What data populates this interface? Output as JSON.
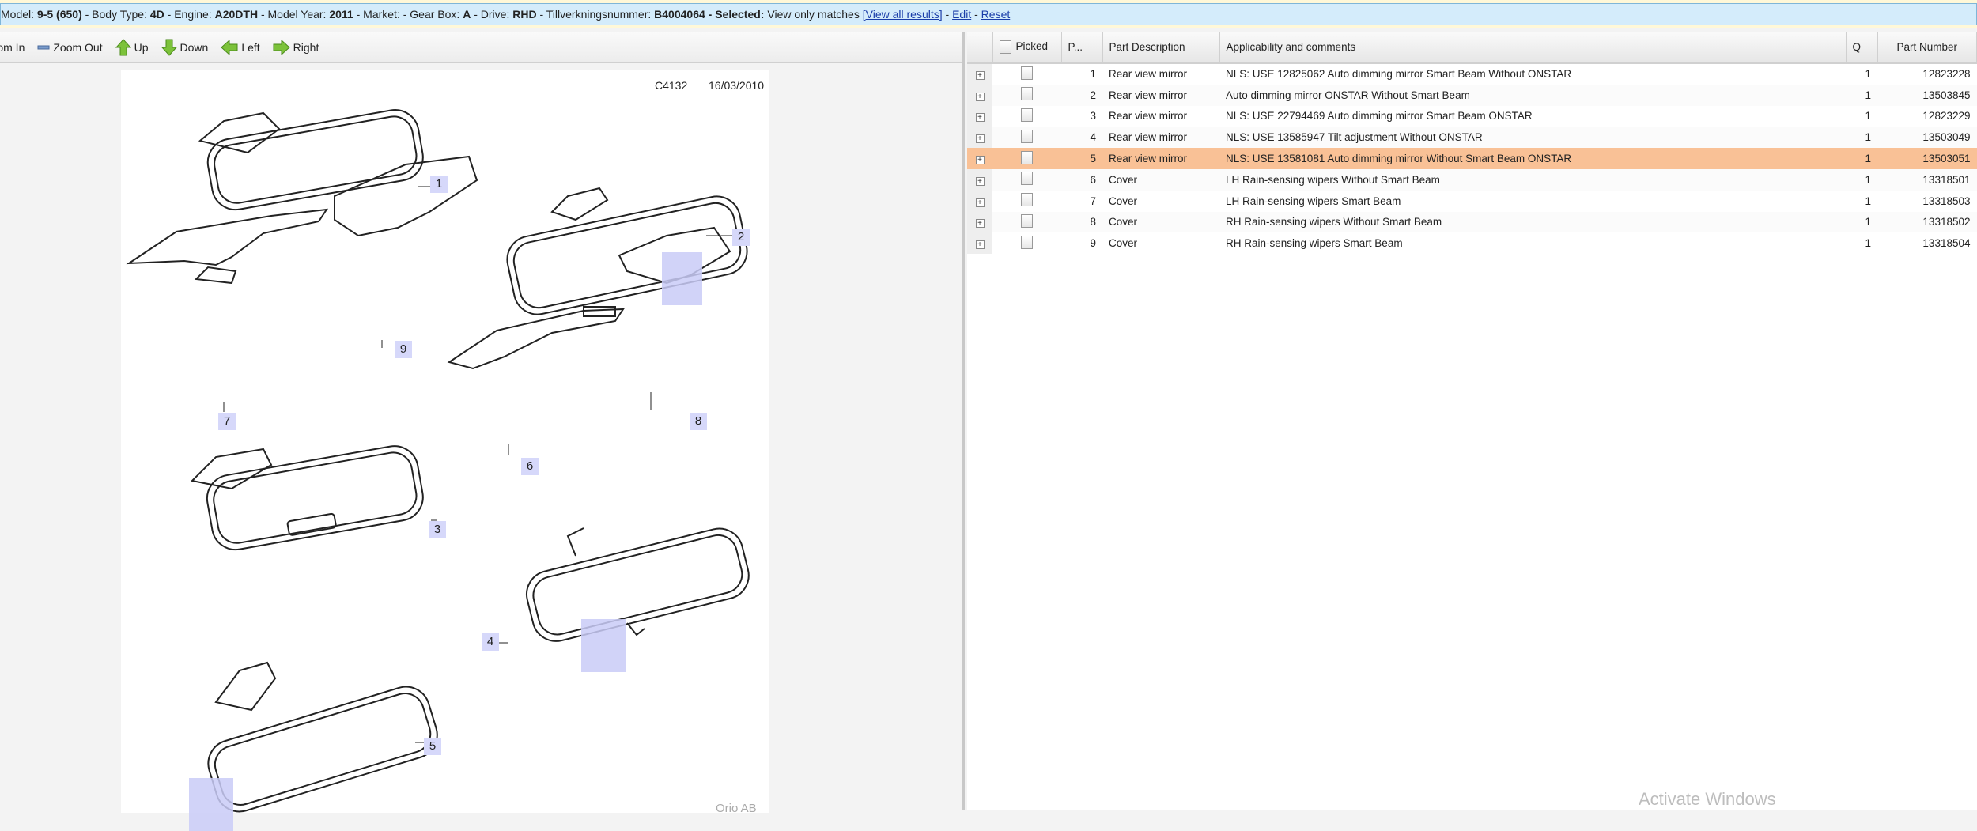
{
  "info_bar": {
    "model_label": "Model:",
    "model": "9-5 (650)",
    "body_label": " - Body Type: ",
    "body": "4D",
    "engine_label": " - Engine: ",
    "engine": "A20DTH",
    "year_label": " - Model Year: ",
    "year": "2011",
    "market_label": " - Market: - Gear Box: ",
    "gearbox": "A",
    "drive_label": " - Drive: ",
    "drive": "RHD",
    "tvn_label": " - Tillverkningsnummer: ",
    "tvn": "B4004064",
    "selected_label": " - Selected:",
    "selected": " View only matches ",
    "view_all": "[View all results]",
    "sep1": " - ",
    "edit": "Edit",
    "sep2": " - ",
    "reset": "Reset"
  },
  "toolbar": {
    "zoom_in": "Zoom In",
    "zoom_out": "Zoom Out",
    "up": "Up",
    "down": "Down",
    "left": "Left",
    "right": "Right"
  },
  "diagram": {
    "code": "C4132",
    "date": "16/03/2010",
    "copyright": "Orio AB",
    "callouts": [
      "1",
      "2",
      "3",
      "4",
      "5",
      "6",
      "7",
      "8",
      "9"
    ]
  },
  "table": {
    "headers": {
      "picked": "Picked",
      "pos": "P...",
      "desc": "Part Description",
      "comments": "Applicability and comments",
      "qty": "Q",
      "part_number": "Part Number"
    },
    "rows": [
      {
        "pos": "1",
        "desc": "Rear view mirror",
        "comments": "NLS: USE 12825062 Auto dimming mirror Smart Beam Without ONSTAR",
        "qty": "1",
        "part_number": "12823228"
      },
      {
        "pos": "2",
        "desc": "Rear view mirror",
        "comments": "Auto dimming mirror ONSTAR Without Smart Beam",
        "qty": "1",
        "part_number": "13503845"
      },
      {
        "pos": "3",
        "desc": "Rear view mirror",
        "comments": "NLS: USE 22794469 Auto dimming mirror Smart Beam ONSTAR",
        "qty": "1",
        "part_number": "12823229"
      },
      {
        "pos": "4",
        "desc": "Rear view mirror",
        "comments": "NLS: USE 13585947 Tilt adjustment Without ONSTAR",
        "qty": "1",
        "part_number": "13503049"
      },
      {
        "pos": "5",
        "desc": "Rear view mirror",
        "comments": "NLS: USE 13581081 Auto dimming mirror Without Smart Beam ONSTAR",
        "qty": "1",
        "part_number": "13503051",
        "selected": true
      },
      {
        "pos": "6",
        "desc": "Cover",
        "comments": "LH Rain-sensing wipers Without Smart Beam",
        "qty": "1",
        "part_number": "13318501"
      },
      {
        "pos": "7",
        "desc": "Cover",
        "comments": "LH Rain-sensing wipers Smart Beam",
        "qty": "1",
        "part_number": "13318503"
      },
      {
        "pos": "8",
        "desc": "Cover",
        "comments": "RH Rain-sensing wipers Without Smart Beam",
        "qty": "1",
        "part_number": "13318502"
      },
      {
        "pos": "9",
        "desc": "Cover",
        "comments": "RH Rain-sensing wipers Smart Beam",
        "qty": "1",
        "part_number": "13318504"
      }
    ]
  },
  "watermark": "Activate Windows",
  "colors": {
    "selected_row": "#f9c196",
    "info_bar": "#d4ecfb",
    "callout": "#d6d8fa"
  }
}
